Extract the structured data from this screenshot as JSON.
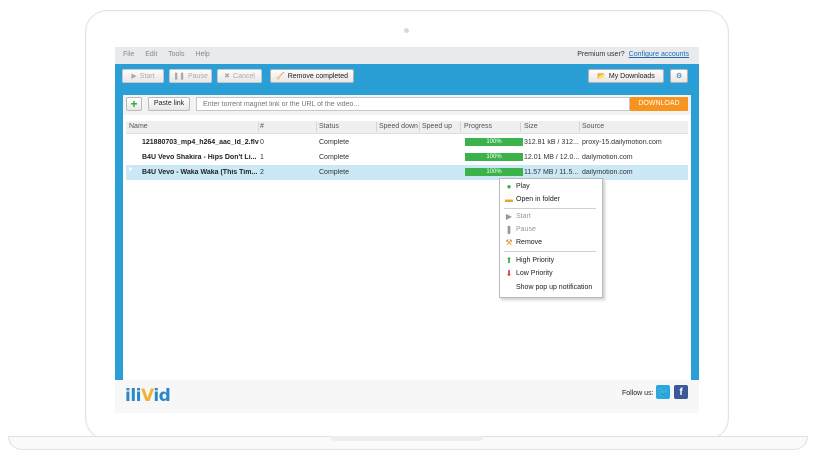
{
  "menu": {
    "items": [
      "File",
      "Edit",
      "Tools",
      "Help"
    ],
    "premium_label": "Premium user?",
    "configure_link": "Configure accounts"
  },
  "toolbar": {
    "start": "Start",
    "pause": "Pause",
    "cancel": "Cancel",
    "remove_completed": "Remove completed",
    "my_downloads": "My Downloads"
  },
  "url_bar": {
    "add_icon": "plus-icon",
    "paste_link": "Paste link",
    "placeholder": "Enter torrent magnet link or the URL of the video...",
    "download": "DOWNLOAD"
  },
  "table": {
    "columns": [
      "Name",
      "#",
      "Status",
      "Speed down",
      "Speed up",
      "Progress",
      "Size",
      "Source"
    ],
    "rows": [
      {
        "name": "121880703_mp4_h264_aac_ld_2.flv",
        "num": "0",
        "status": "Complete",
        "speed_down": "",
        "speed_up": "",
        "progress": "100%",
        "size": "312.81 kB / 312....",
        "source": "proxy-15.dailymotion.com"
      },
      {
        "name": "B4U Vevo Shakira - Hips Don't Li...",
        "num": "1",
        "status": "Complete",
        "speed_down": "",
        "speed_up": "",
        "progress": "100%",
        "size": "12.01 MB / 12.0...",
        "source": "dailymotion.com"
      },
      {
        "name": "B4U Vevo - Waka Waka (This Tim...",
        "num": "2",
        "status": "Complete",
        "speed_down": "",
        "speed_up": "",
        "progress": "100%",
        "size": "11.57 MB / 11.5...",
        "source": "dailymotion.com"
      }
    ]
  },
  "context_menu": {
    "play": "Play",
    "open_folder": "Open in folder",
    "start": "Start",
    "pause": "Pause",
    "remove": "Remove",
    "high_priority": "High Priority",
    "low_priority": "Low Priority",
    "show_popup": "Show pop up notification"
  },
  "footer": {
    "logo_pre": "ili",
    "logo_v": "V",
    "logo_post": "id",
    "follow": "Follow us:",
    "twitter_icon": "twitter-icon",
    "facebook_icon": "facebook-icon",
    "facebook_glyph": "f"
  },
  "colors": {
    "accent_blue": "#2a9fd6",
    "download_orange": "#f7941d",
    "progress_green": "#3bb34a"
  }
}
